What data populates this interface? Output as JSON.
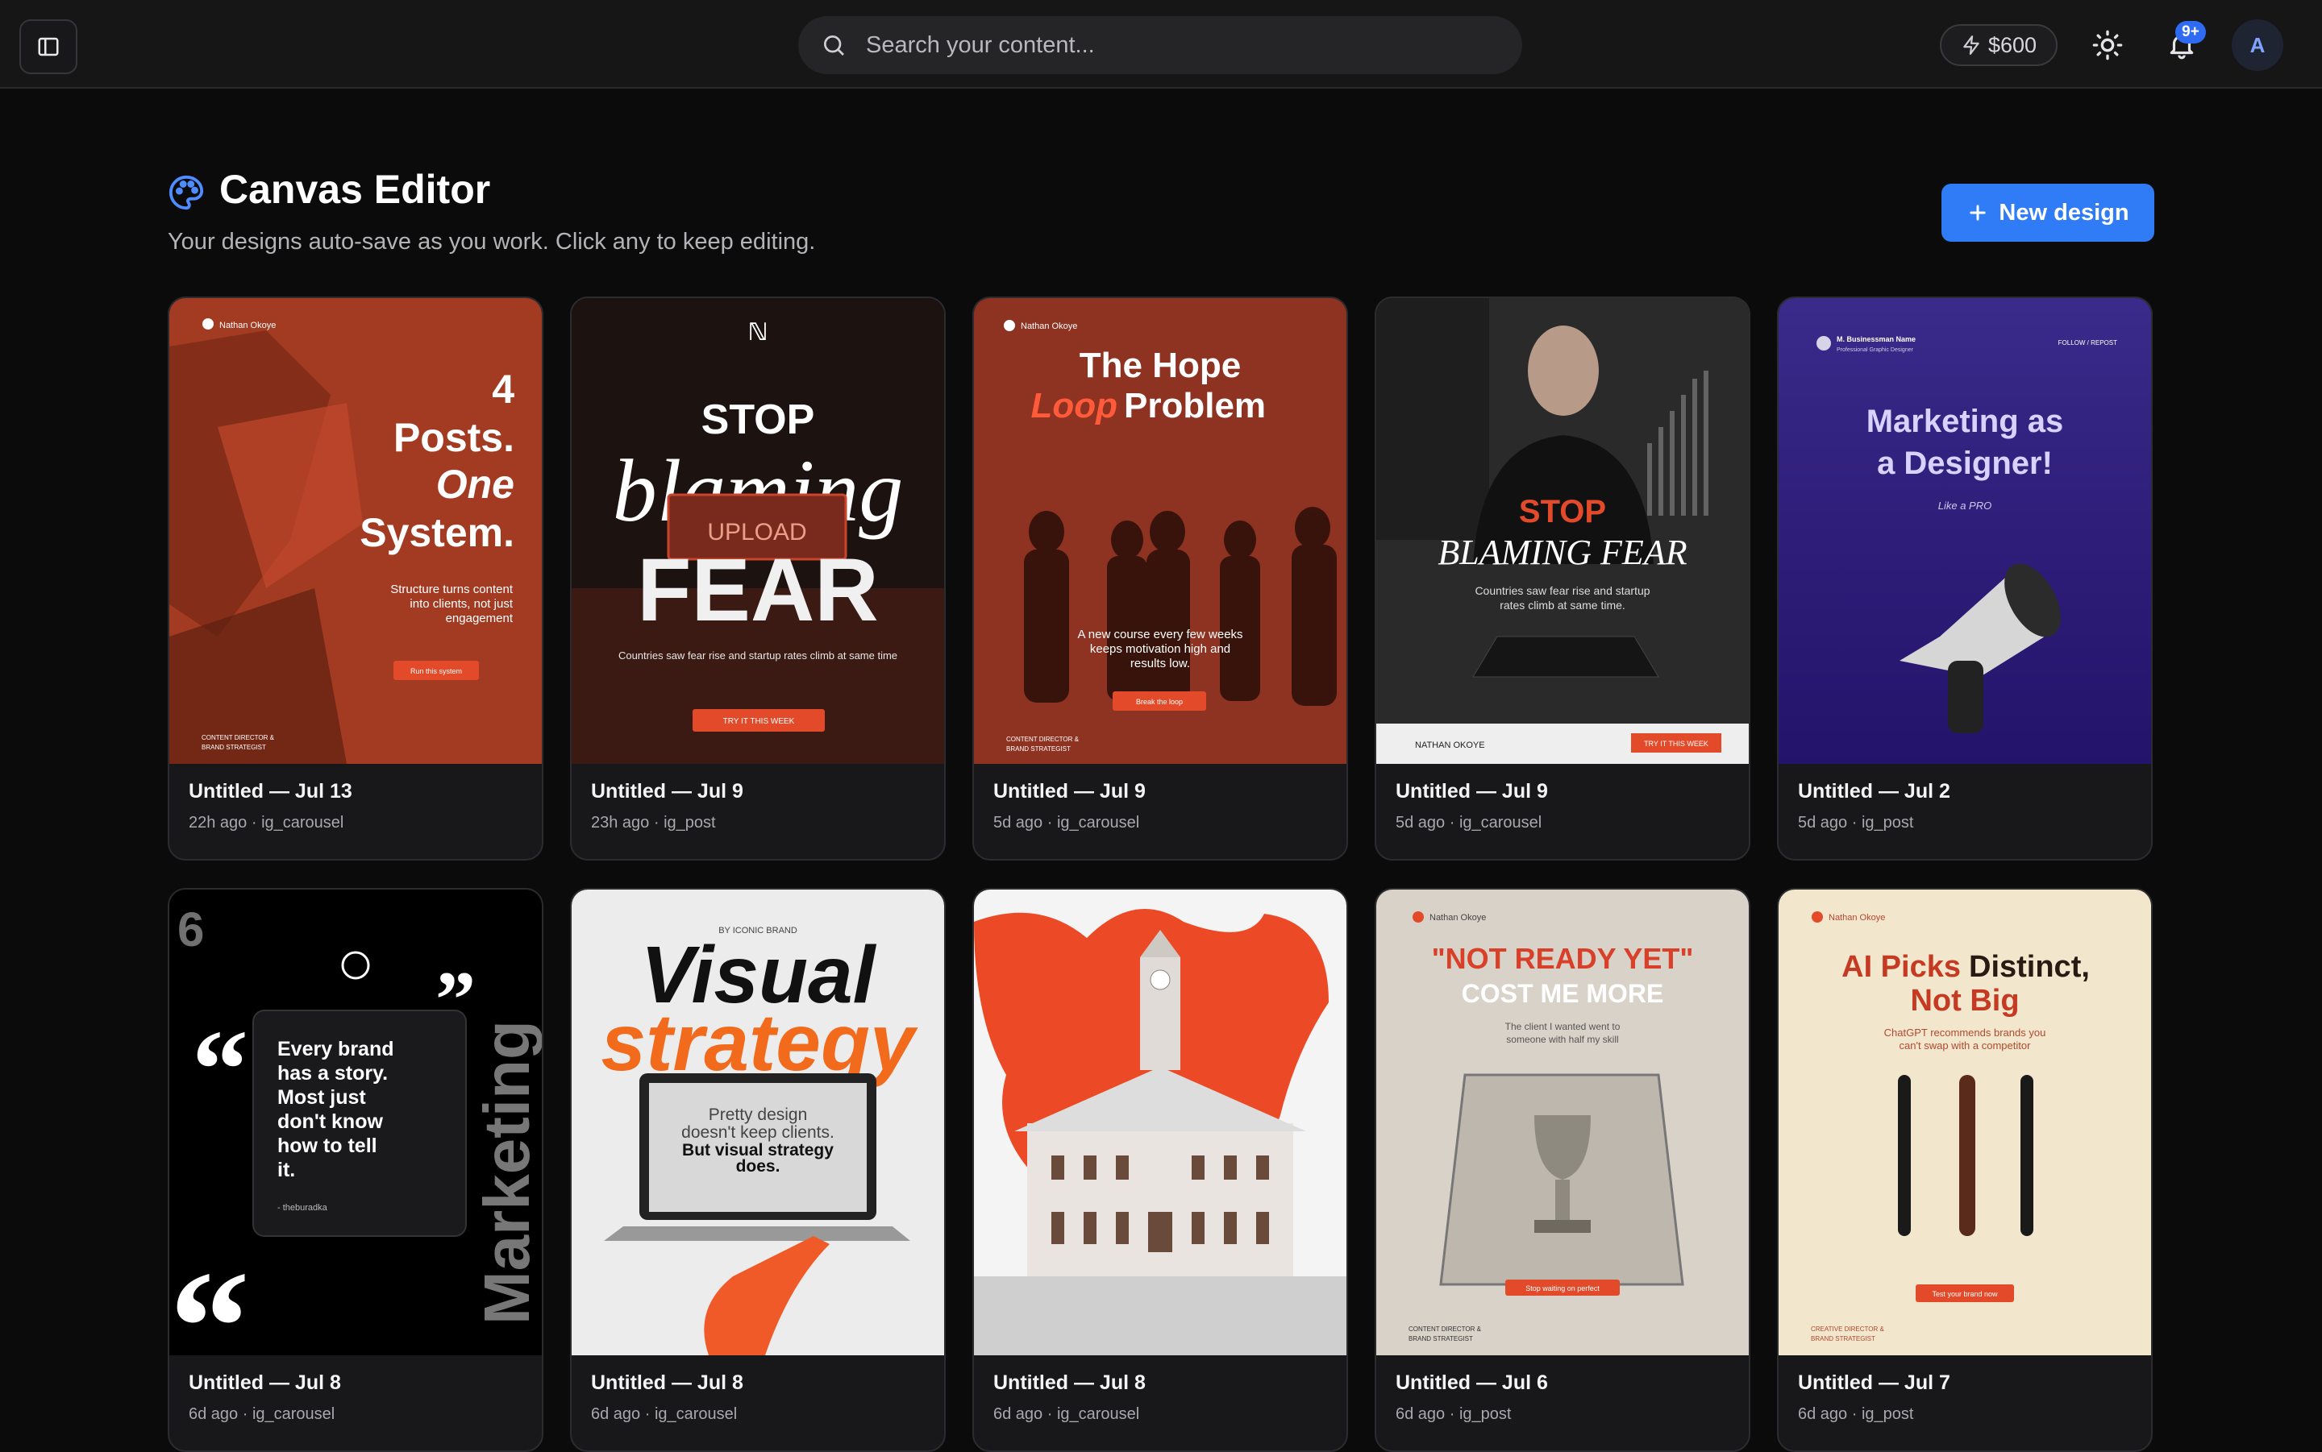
{
  "topbar": {
    "search_placeholder": "Search your content...",
    "credits": "$600",
    "notifications_badge": "9+",
    "avatar_initial": "A"
  },
  "header": {
    "title": "Canvas Editor",
    "subtitle": "Your designs auto-save as you work. Click any to keep editing.",
    "new_design_label": "New design"
  },
  "designs": [
    {
      "title": "Untitled — Jul 13",
      "meta": "22h ago · ig_carousel",
      "thumb": {
        "brand": "Nathan Okoye",
        "l1": "4",
        "l2": "Posts.",
        "l3": "One",
        "l4": "System.",
        "body1": "Structure turns content",
        "body2": "into clients, not just",
        "body3": "engagement",
        "cta": "Run this system",
        "foot1": "CONTENT DIRECTOR &",
        "foot2": "BRAND STRATEGIST"
      }
    },
    {
      "title": "Untitled — Jul 9",
      "meta": "23h ago · ig_post",
      "thumb": {
        "l1": "STOP",
        "l2": "blaming",
        "l3": "FEAR",
        "upload": "UPLOAD",
        "body": "Countries saw fear rise and startup rates climb at same time",
        "cta": "TRY IT THIS WEEK"
      }
    },
    {
      "title": "Untitled — Jul 9",
      "meta": "5d ago · ig_carousel",
      "thumb": {
        "brand": "Nathan Okoye",
        "l1": "The Hope",
        "l2a": "Loop",
        "l2b": "Problem",
        "body1": "A new course every few weeks",
        "body2": "keeps motivation high and",
        "body3": "results low.",
        "cta": "Break the loop",
        "foot1": "CONTENT DIRECTOR &",
        "foot2": "BRAND STRATEGIST"
      }
    },
    {
      "title": "Untitled — Jul 9",
      "meta": "5d ago · ig_carousel",
      "thumb": {
        "l1": "STOP",
        "l2": "BLAMING FEAR",
        "body1": "Countries saw fear rise and startup",
        "body2": "rates climb at same time.",
        "brand": "NATHAN OKOYE",
        "cta": "TRY IT THIS WEEK"
      }
    },
    {
      "title": "Untitled — Jul 2",
      "meta": "5d ago · ig_post",
      "thumb": {
        "brand": "M. Businessman Name",
        "brand_sub": "Professional Graphic Designer",
        "tag": "FOLLOW / REPOST",
        "l1": "Marketing as",
        "l2": "a Designer!",
        "l3": "Like a PRO"
      }
    },
    {
      "title": "Untitled — Jul 8",
      "meta": "6d ago · ig_carousel",
      "thumb": {
        "q1": "Every brand",
        "q2": "has a story.",
        "q3": "Most just",
        "q4": "don't know",
        "q5": "how to tell",
        "q6": "it.",
        "author": "- theburadka",
        "vertical": "Marketing"
      }
    },
    {
      "title": "Untitled — Jul 8",
      "meta": "6d ago · ig_carousel",
      "thumb": {
        "kicker": "BY ICONIC BRAND",
        "l1": "Visual",
        "l2": "strategy",
        "s1": "Pretty design",
        "s2": "doesn't keep clients.",
        "s3": "But visual strategy",
        "s4": "does."
      }
    },
    {
      "title": "Untitled — Jul 8",
      "meta": "6d ago · ig_carousel",
      "thumb": {}
    },
    {
      "title": "Untitled — Jul 6",
      "meta": "6d ago · ig_post",
      "thumb": {
        "brand": "Nathan Okoye",
        "l1": "\"NOT READY YET\"",
        "l2": "COST ME MORE",
        "body1": "The client I wanted went to",
        "body2": "someone with half my skill",
        "cta": "Stop waiting on perfect",
        "foot1": "CONTENT DIRECTOR &",
        "foot2": "BRAND STRATEGIST"
      }
    },
    {
      "title": "Untitled — Jul 7",
      "meta": "6d ago · ig_post",
      "thumb": {
        "brand": "Nathan Okoye",
        "l1a": "AI Picks",
        "l1b": "Distinct,",
        "l2": "Not Big",
        "body1": "ChatGPT recommends brands you",
        "body2": "can't swap with a competitor",
        "cta": "Test your brand now",
        "foot1": "CREATIVE DIRECTOR &",
        "foot2": "BRAND STRATEGIST"
      }
    }
  ]
}
